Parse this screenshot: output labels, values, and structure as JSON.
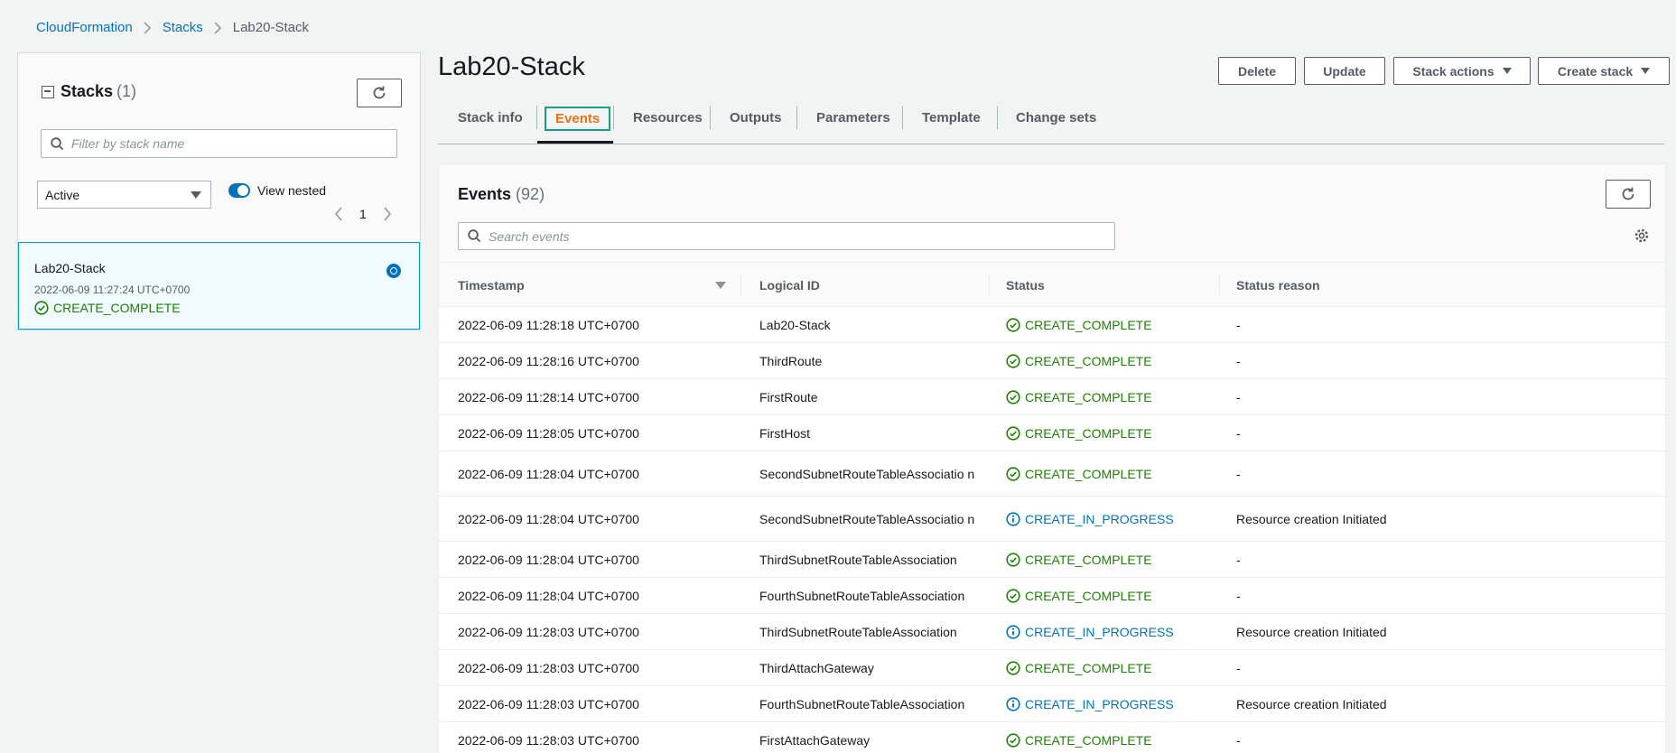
{
  "breadcrumb": {
    "items": [
      "CloudFormation",
      "Stacks"
    ],
    "current": "Lab20-Stack"
  },
  "left_panel": {
    "title": "Stacks",
    "count": "(1)",
    "filter_placeholder": "Filter by stack name",
    "status_filter": "Active",
    "view_nested_label": "View nested",
    "page": "1",
    "stack": {
      "name": "Lab20-Stack",
      "date": "2022-06-09 11:27:24 UTC+0700",
      "status": "CREATE_COMPLETE"
    }
  },
  "main": {
    "title": "Lab20-Stack",
    "actions": {
      "delete": "Delete",
      "update": "Update",
      "stack_actions": "Stack actions",
      "create_stack": "Create stack"
    },
    "tabs": [
      "Stack info",
      "Events",
      "Resources",
      "Outputs",
      "Parameters",
      "Template",
      "Change sets"
    ],
    "active_tab": "Events"
  },
  "events": {
    "title": "Events",
    "count": "(92)",
    "search_placeholder": "Search events",
    "columns": [
      "Timestamp",
      "Logical ID",
      "Status",
      "Status reason"
    ],
    "rows": [
      {
        "timestamp": "2022-06-09 11:28:18 UTC+0700",
        "logical_id": "Lab20-Stack",
        "status": "CREATE_COMPLETE",
        "reason": "-"
      },
      {
        "timestamp": "2022-06-09 11:28:16 UTC+0700",
        "logical_id": "ThirdRoute",
        "status": "CREATE_COMPLETE",
        "reason": "-"
      },
      {
        "timestamp": "2022-06-09 11:28:14 UTC+0700",
        "logical_id": "FirstRoute",
        "status": "CREATE_COMPLETE",
        "reason": "-"
      },
      {
        "timestamp": "2022-06-09 11:28:05 UTC+0700",
        "logical_id": "FirstHost",
        "status": "CREATE_COMPLETE",
        "reason": "-"
      },
      {
        "timestamp": "2022-06-09 11:28:04 UTC+0700",
        "logical_id": "SecondSubnetRouteTableAssociatio n",
        "status": "CREATE_COMPLETE",
        "reason": "-"
      },
      {
        "timestamp": "2022-06-09 11:28:04 UTC+0700",
        "logical_id": "SecondSubnetRouteTableAssociatio n",
        "status": "CREATE_IN_PROGRESS",
        "reason": "Resource creation Initiated"
      },
      {
        "timestamp": "2022-06-09 11:28:04 UTC+0700",
        "logical_id": "ThirdSubnetRouteTableAssociation",
        "status": "CREATE_COMPLETE",
        "reason": "-"
      },
      {
        "timestamp": "2022-06-09 11:28:04 UTC+0700",
        "logical_id": "FourthSubnetRouteTableAssociation",
        "status": "CREATE_COMPLETE",
        "reason": "-"
      },
      {
        "timestamp": "2022-06-09 11:28:03 UTC+0700",
        "logical_id": "ThirdSubnetRouteTableAssociation",
        "status": "CREATE_IN_PROGRESS",
        "reason": "Resource creation Initiated"
      },
      {
        "timestamp": "2022-06-09 11:28:03 UTC+0700",
        "logical_id": "ThirdAttachGateway",
        "status": "CREATE_COMPLETE",
        "reason": "-"
      },
      {
        "timestamp": "2022-06-09 11:28:03 UTC+0700",
        "logical_id": "FourthSubnetRouteTableAssociation",
        "status": "CREATE_IN_PROGRESS",
        "reason": "Resource creation Initiated"
      },
      {
        "timestamp": "2022-06-09 11:28:03 UTC+0700",
        "logical_id": "FirstAttachGateway",
        "status": "CREATE_COMPLETE",
        "reason": "-"
      }
    ]
  },
  "colors": {
    "link": "#0073bb",
    "success": "#1d8102",
    "info": "#0073bb",
    "active_tab": "#ec7211",
    "selected_bg": "#f1faff"
  }
}
